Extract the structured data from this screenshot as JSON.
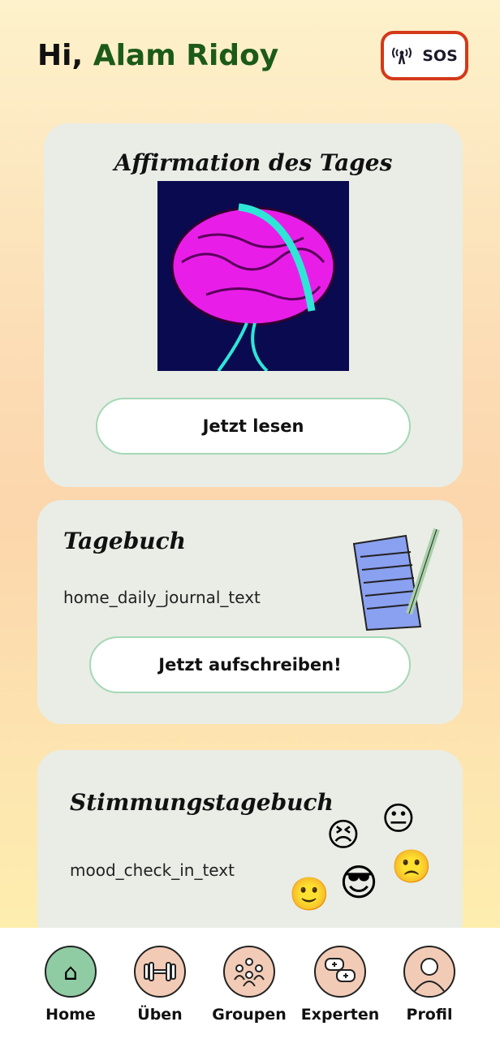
{
  "header": {
    "greeting": "Hi,",
    "user_name": "Alam Ridoy",
    "sos_label": "SOS"
  },
  "affirmation": {
    "title": "Affirmation des Tages",
    "button": "Jetzt lesen"
  },
  "journal": {
    "title": "Tagebuch",
    "text": "home_daily_journal_text",
    "button": "Jetzt aufschreiben!"
  },
  "mood": {
    "title": "Stimmungstagebuch",
    "text": "mood_check_in_text",
    "emojis": [
      "😣",
      "😐",
      "😎",
      "🙁",
      "🙂"
    ]
  },
  "nav": {
    "items": [
      {
        "label": "Home",
        "icon": "house-icon",
        "active": true
      },
      {
        "label": "Üben",
        "icon": "dumbbell-icon"
      },
      {
        "label": "Groupen",
        "icon": "group-icon"
      },
      {
        "label": "Experten",
        "icon": "chat-icon"
      },
      {
        "label": "Profil",
        "icon": "person-icon"
      }
    ]
  },
  "colors": {
    "accent": "#1c5a17",
    "sos": "#d4391a",
    "card": "#e9ede6",
    "active_nav": "#8fcca4",
    "nav_circle": "#f2cbb6"
  }
}
